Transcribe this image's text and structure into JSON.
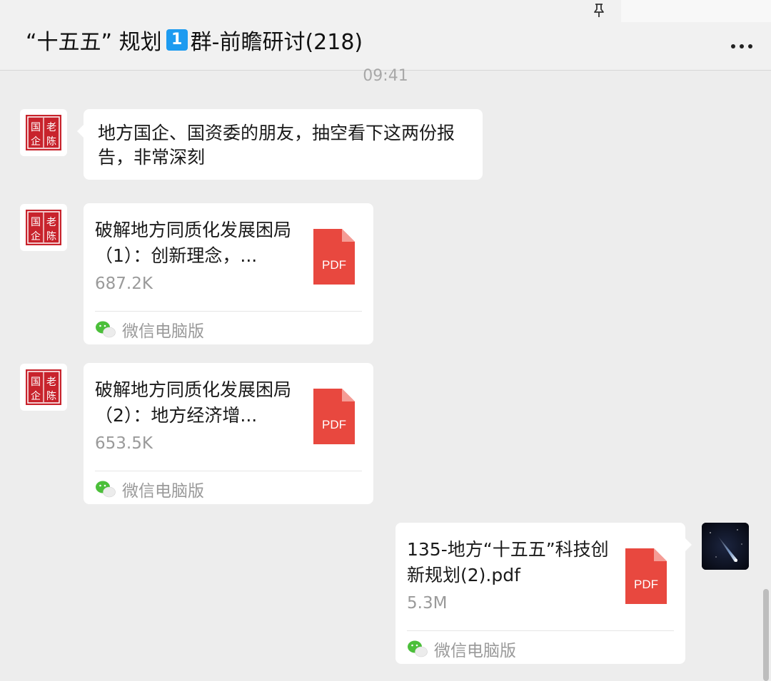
{
  "header": {
    "title_part1": "“十五五” 规划",
    "badge": "1",
    "title_part2": "群-前瞻研讨(218)",
    "pin_icon": "pin-icon",
    "more_icon": "more-dots-icon"
  },
  "chat": {
    "timestamp": "09:41",
    "messages": [
      {
        "type": "text",
        "text": "地方国企、国资委的朋友，抽空看下这两份报告，非常深刻",
        "avatar": "seal-avatar"
      },
      {
        "type": "file",
        "name": "破解地方同质化发展困局（1）：创新理念，...",
        "size": "687.2K",
        "file_type": "PDF",
        "source": "微信电脑版",
        "avatar": "seal-avatar"
      },
      {
        "type": "file",
        "name": "破解地方同质化发展困局（2）：地方经济增...",
        "size": "653.5K",
        "file_type": "PDF",
        "source": "微信电脑版",
        "avatar": "seal-avatar"
      },
      {
        "type": "file",
        "name": "135-地方“十五五”科技创新规划(2).pdf",
        "size": "5.3M",
        "file_type": "PDF",
        "source": "微信电脑版",
        "avatar": "night-sky-avatar"
      }
    ]
  },
  "colors": {
    "background": "#ededed",
    "bubble": "#ffffff",
    "pdf_red": "#e8483f",
    "wechat_green": "#4bbf3a",
    "badge_blue": "#1d9bf0"
  }
}
